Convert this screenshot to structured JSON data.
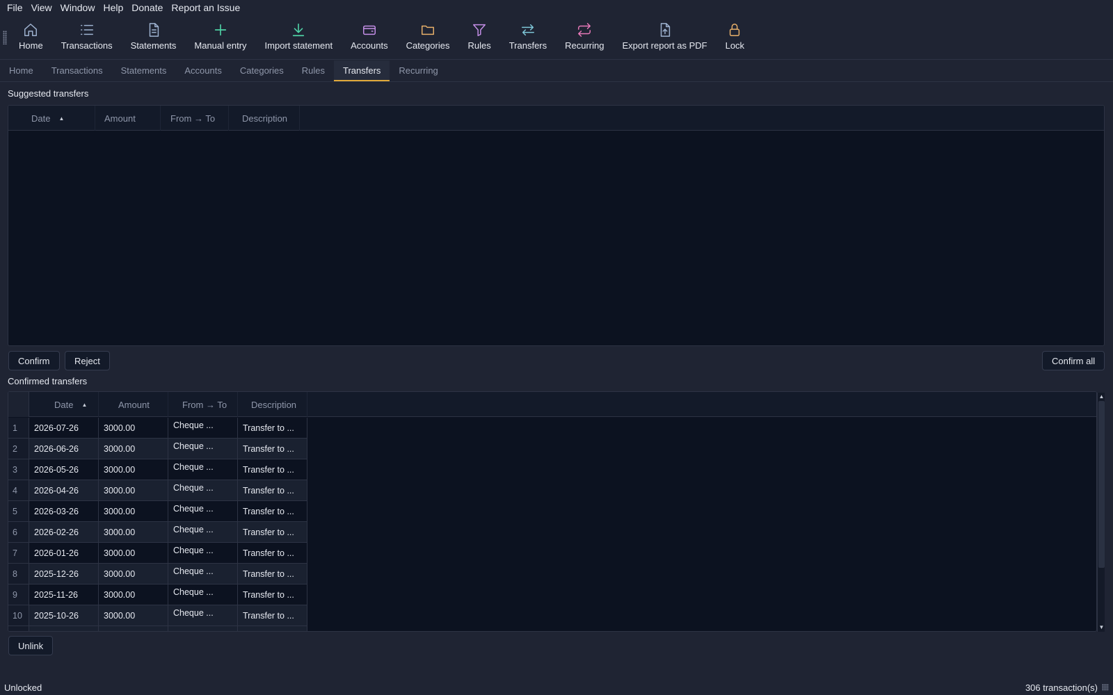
{
  "menu": [
    "File",
    "View",
    "Window",
    "Help",
    "Donate",
    "Report an Issue"
  ],
  "toolbar": [
    {
      "label": "Home",
      "icon": "home-icon",
      "color": "#9fb3d1"
    },
    {
      "label": "Transactions",
      "icon": "list-icon",
      "color": "#9fb3d1"
    },
    {
      "label": "Statements",
      "icon": "document-icon",
      "color": "#9fb3d1"
    },
    {
      "label": "Manual entry",
      "icon": "plus-icon",
      "color": "#4fd1a5"
    },
    {
      "label": "Import statement",
      "icon": "download-icon",
      "color": "#4fd1a5"
    },
    {
      "label": "Accounts",
      "icon": "wallet-icon",
      "color": "#c58fe8"
    },
    {
      "label": "Categories",
      "icon": "folder-icon",
      "color": "#e8b06a"
    },
    {
      "label": "Rules",
      "icon": "filter-icon",
      "color": "#c58fe8"
    },
    {
      "label": "Transfers",
      "icon": "arrows-swap-icon",
      "color": "#7fc7d9"
    },
    {
      "label": "Recurring",
      "icon": "repeat-icon",
      "color": "#e879b9"
    },
    {
      "label": "Export report as PDF",
      "icon": "file-export-icon",
      "color": "#9fb3d1"
    },
    {
      "label": "Lock",
      "icon": "lock-icon",
      "color": "#e8b06a"
    }
  ],
  "tabs": [
    "Home",
    "Transactions",
    "Statements",
    "Accounts",
    "Categories",
    "Rules",
    "Transfers",
    "Recurring"
  ],
  "active_tab": "Transfers",
  "suggested": {
    "title": "Suggested transfers",
    "columns": [
      "Date",
      "Amount",
      "From → To",
      "Description"
    ]
  },
  "buttons": {
    "confirm": "Confirm",
    "reject": "Reject",
    "confirm_all": "Confirm all",
    "unlink": "Unlink"
  },
  "confirmed": {
    "title": "Confirmed transfers",
    "columns": [
      "Date",
      "Amount",
      "From → To",
      "Description"
    ],
    "rows": [
      {
        "n": "1",
        "date": "2026-07-26",
        "amount": "3000.00",
        "from_to": "Cheque ...",
        "desc": "Transfer to ..."
      },
      {
        "n": "2",
        "date": "2026-06-26",
        "amount": "3000.00",
        "from_to": "Cheque ...",
        "desc": "Transfer to ..."
      },
      {
        "n": "3",
        "date": "2026-05-26",
        "amount": "3000.00",
        "from_to": "Cheque ...",
        "desc": "Transfer to ..."
      },
      {
        "n": "4",
        "date": "2026-04-26",
        "amount": "3000.00",
        "from_to": "Cheque ...",
        "desc": "Transfer to ..."
      },
      {
        "n": "5",
        "date": "2026-03-26",
        "amount": "3000.00",
        "from_to": "Cheque ...",
        "desc": "Transfer to ..."
      },
      {
        "n": "6",
        "date": "2026-02-26",
        "amount": "3000.00",
        "from_to": "Cheque ...",
        "desc": "Transfer to ..."
      },
      {
        "n": "7",
        "date": "2026-01-26",
        "amount": "3000.00",
        "from_to": "Cheque ...",
        "desc": "Transfer to ..."
      },
      {
        "n": "8",
        "date": "2025-12-26",
        "amount": "3000.00",
        "from_to": "Cheque ...",
        "desc": "Transfer to ..."
      },
      {
        "n": "9",
        "date": "2025-11-26",
        "amount": "3000.00",
        "from_to": "Cheque ...",
        "desc": "Transfer to ..."
      },
      {
        "n": "10",
        "date": "2025-10-26",
        "amount": "3000.00",
        "from_to": "Cheque ...",
        "desc": "Transfer to ..."
      }
    ]
  },
  "status": {
    "left": "Unlocked",
    "right": "306 transaction(s)"
  }
}
